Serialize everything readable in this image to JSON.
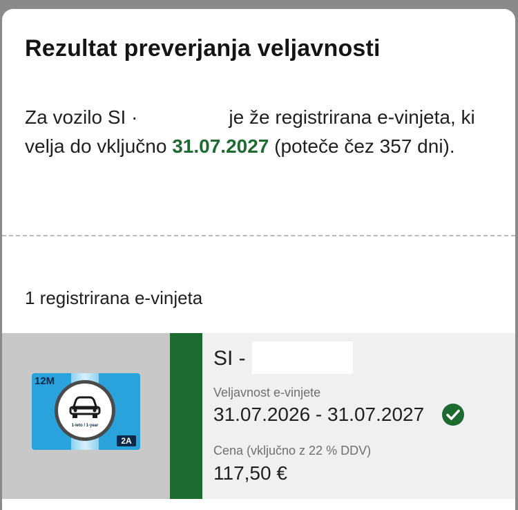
{
  "dialog": {
    "title": "Rezultat preverjanja veljavnosti",
    "message_before_plate": "Za vozilo SI ·",
    "message_after_plate": "je že registrirana e-vinjeta, ki velja do vključno",
    "valid_until": "31.07.2027",
    "message_tail": "(poteče čez 357 dni).",
    "accent_color": "#1e6b32"
  },
  "registrations": {
    "count_text": "1 registrirana e-vinjeta",
    "items": [
      {
        "sticker": {
          "type": "12M",
          "period": "1-leto / 1-year",
          "vehicle_class": "2A",
          "icon": "car-icon"
        },
        "plate_prefix": "SI -",
        "validity_label": "Veljavnost e-vinjete",
        "validity_range": "31.07.2026 - 31.07.2027",
        "status_icon": "check-circle-icon",
        "price_label": "Cena (vključno z 22 % DDV)",
        "price_value": "117,50 €"
      }
    ]
  }
}
